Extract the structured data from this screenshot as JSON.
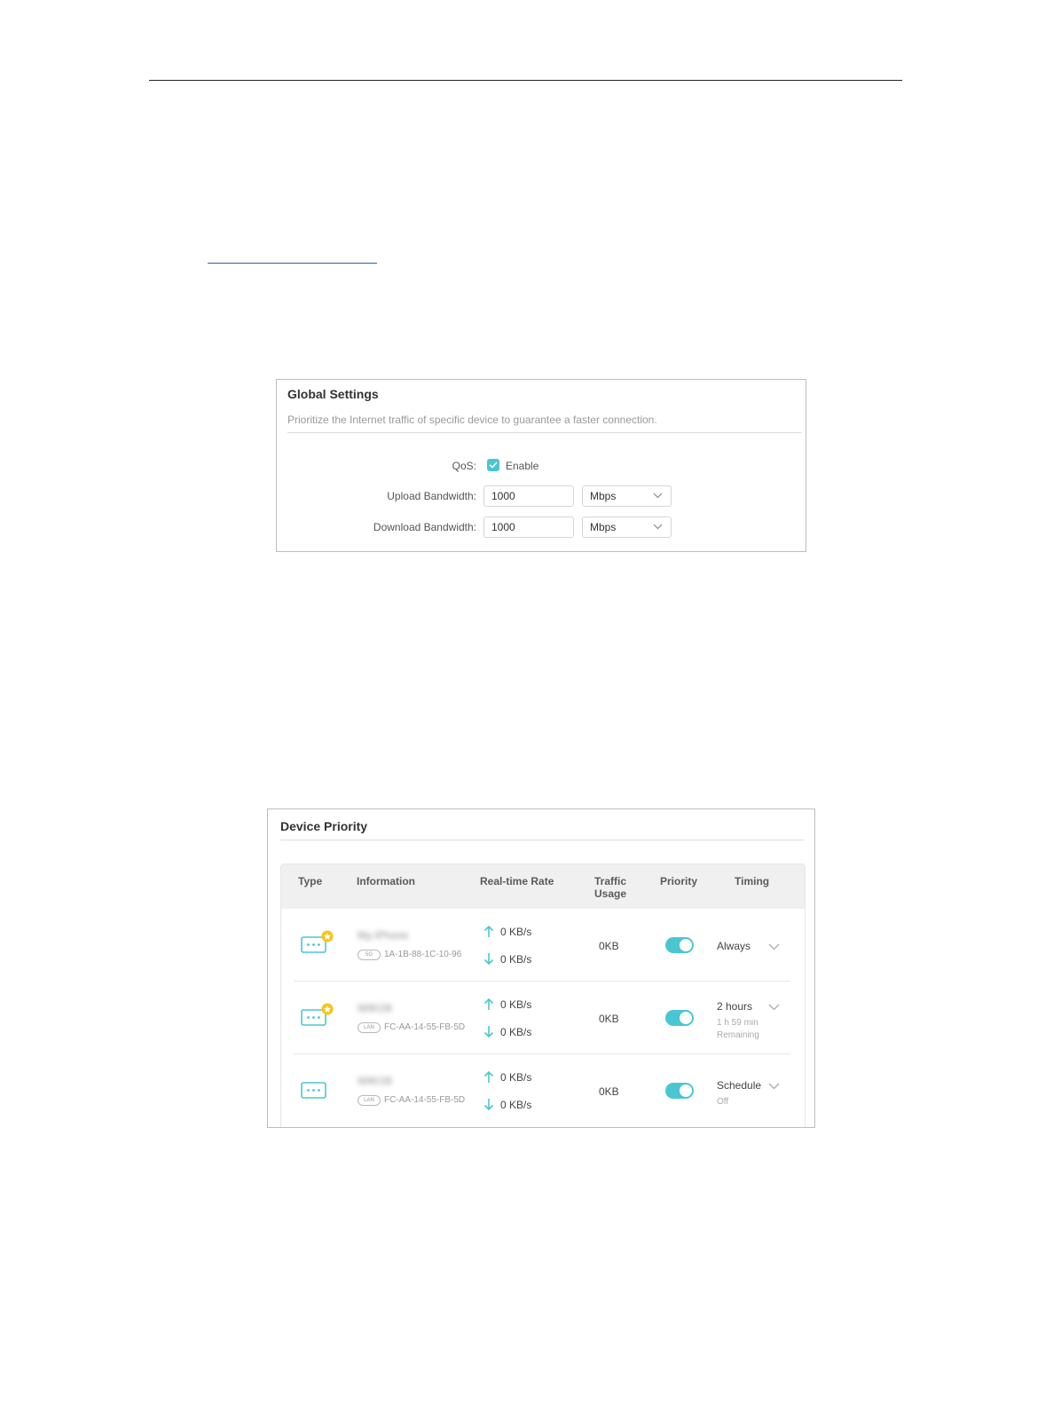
{
  "global_settings": {
    "title": "Global Settings",
    "description": "Prioritize the Internet traffic of specific device to guarantee a faster connection.",
    "qos_label": "QoS:",
    "qos_checkbox_label": "Enable",
    "qos_enabled": true,
    "upload_label": "Upload Bandwidth:",
    "upload_value": "1000",
    "upload_unit": "Mbps",
    "download_label": "Download Bandwidth:",
    "download_value": "1000",
    "download_unit": "Mbps"
  },
  "device_priority": {
    "title": "Device Priority",
    "columns": {
      "type": "Type",
      "information": "Information",
      "rate": "Real-time Rate",
      "usage_line1": "Traffic",
      "usage_line2": "Usage",
      "priority": "Priority",
      "timing": "Timing"
    },
    "rows": [
      {
        "name": "My-iPhone",
        "connection": "5G",
        "mac": "1A-1B-88-1C-10-96",
        "upload_rate": "0 KB/s",
        "download_rate": "0 KB/s",
        "traffic_usage": "0KB",
        "priority_on": true,
        "timing": "Always",
        "timing_sub_1": "",
        "timing_sub_2": "",
        "starred": true
      },
      {
        "name": "WIKO8",
        "connection": "LAN",
        "mac": "FC-AA-14-55-FB-5D",
        "upload_rate": "0 KB/s",
        "download_rate": "0 KB/s",
        "traffic_usage": "0KB",
        "priority_on": true,
        "timing": "2 hours",
        "timing_sub_1": "1 h 59 min",
        "timing_sub_2": "Remaining",
        "starred": true
      },
      {
        "name": "WIKO8",
        "connection": "LAN",
        "mac": "FC-AA-14-55-FB-5D",
        "upload_rate": "0 KB/s",
        "download_rate": "0 KB/s",
        "traffic_usage": "0KB",
        "priority_on": true,
        "timing": "Schedule",
        "timing_sub_1": "Off",
        "timing_sub_2": "",
        "starred": false
      }
    ]
  },
  "colors": {
    "accent": "#4ac6d2",
    "star": "#f5c518",
    "border": "#bdbdbd"
  }
}
